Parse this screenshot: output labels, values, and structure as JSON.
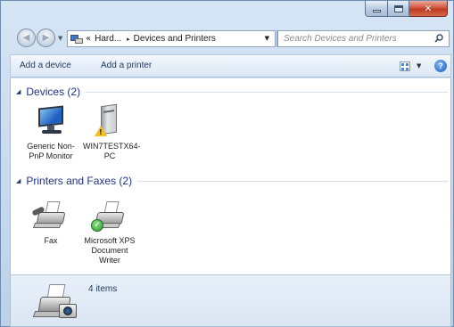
{
  "window": {
    "caption_buttons": {
      "minimize": "minimize-icon",
      "maximize": "maximize-icon",
      "close": "close-icon"
    }
  },
  "navigation": {
    "back_icon": "back-arrow-icon",
    "forward_icon": "forward-arrow-icon"
  },
  "address_bar": {
    "overflow_chevron": "«",
    "crumbs": [
      "Hard...",
      "Devices and Printers"
    ],
    "separator": "▸"
  },
  "search": {
    "placeholder": "Search Devices and Printers"
  },
  "command_bar": {
    "add_device": "Add a device",
    "add_printer": "Add a printer",
    "help": "?"
  },
  "groups": {
    "devices": {
      "title": "Devices (2)",
      "items": [
        {
          "label": "Generic Non-PnP Monitor",
          "icon": "monitor-icon"
        },
        {
          "label": "WIN7TESTX64-PC",
          "icon": "computer-warning-icon"
        }
      ]
    },
    "printers": {
      "title": "Printers and Faxes (2)",
      "items": [
        {
          "label": "Fax",
          "icon": "fax-icon"
        },
        {
          "label": "Microsoft XPS Document Writer",
          "icon": "default-printer-icon"
        }
      ]
    }
  },
  "details": {
    "text": "4 items",
    "icon": "printer-camera-icon"
  },
  "colors": {
    "accent_title": "#1e3287",
    "command_text": "#1e395b"
  }
}
